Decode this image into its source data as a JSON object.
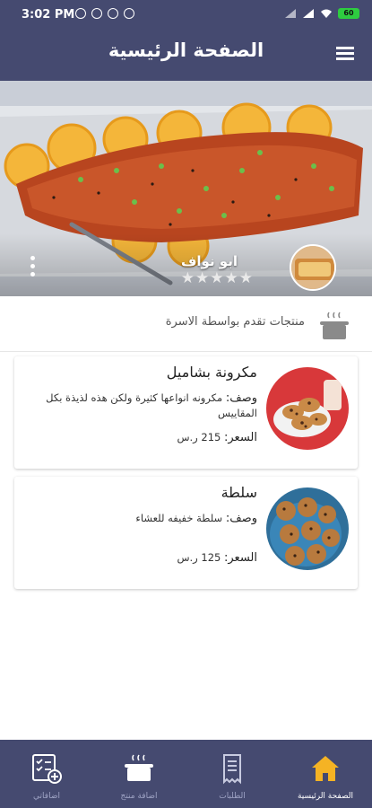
{
  "status_bar": {
    "time": "3:02 PM",
    "battery": "60"
  },
  "app_bar": {
    "title": "الصفحة الرئيسية",
    "menu_icon": "hamburger-menu-icon"
  },
  "hero": {
    "vendor_name": "ابو نواف",
    "rating_stars": "★★★★★",
    "rating_value": 0,
    "rating_max": 5
  },
  "section": {
    "label": "منتجات تقدم بواسطة الاسرة",
    "icon": "cooking-pot-icon"
  },
  "products": [
    {
      "name": "مكرونة بشاميل",
      "desc_label": "وصف:",
      "desc": "مكرونه انواعها كثيرة ولكن هذه لذيذة بكل المقاييس",
      "price_label": "السعر:",
      "price": "215 ر.س"
    },
    {
      "name": "سلطة",
      "desc_label": "وصف:",
      "desc": "سلطة خفيفه للعشاء",
      "price_label": "السعر:",
      "price": "125 ر.س"
    }
  ],
  "bottom_nav": {
    "items": [
      {
        "label": "الصفحة الرئيسية",
        "icon": "home-icon",
        "active": true
      },
      {
        "label": "الطلبات",
        "icon": "receipt-icon",
        "active": false
      },
      {
        "label": "اضافة منتج",
        "icon": "cooking-pot-icon",
        "active": false
      },
      {
        "label": "اضافاتي",
        "icon": "checklist-add-icon",
        "active": false
      }
    ]
  },
  "colors": {
    "primary": "#454a70",
    "active_icon": "#f5b324",
    "inactive_label": "#9ea3c4"
  }
}
